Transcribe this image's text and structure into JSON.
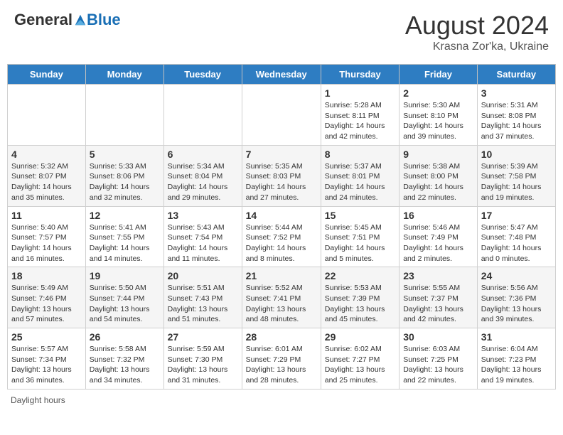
{
  "header": {
    "logo": {
      "general": "General",
      "blue": "Blue"
    },
    "title": "August 2024",
    "subtitle": "Krasna Zor'ka, Ukraine"
  },
  "calendar": {
    "days_of_week": [
      "Sunday",
      "Monday",
      "Tuesday",
      "Wednesday",
      "Thursday",
      "Friday",
      "Saturday"
    ],
    "weeks": [
      [
        {
          "day": "",
          "info": ""
        },
        {
          "day": "",
          "info": ""
        },
        {
          "day": "",
          "info": ""
        },
        {
          "day": "",
          "info": ""
        },
        {
          "day": "1",
          "info": "Sunrise: 5:28 AM\nSunset: 8:11 PM\nDaylight: 14 hours\nand 42 minutes."
        },
        {
          "day": "2",
          "info": "Sunrise: 5:30 AM\nSunset: 8:10 PM\nDaylight: 14 hours\nand 39 minutes."
        },
        {
          "day": "3",
          "info": "Sunrise: 5:31 AM\nSunset: 8:08 PM\nDaylight: 14 hours\nand 37 minutes."
        }
      ],
      [
        {
          "day": "4",
          "info": "Sunrise: 5:32 AM\nSunset: 8:07 PM\nDaylight: 14 hours\nand 35 minutes."
        },
        {
          "day": "5",
          "info": "Sunrise: 5:33 AM\nSunset: 8:06 PM\nDaylight: 14 hours\nand 32 minutes."
        },
        {
          "day": "6",
          "info": "Sunrise: 5:34 AM\nSunset: 8:04 PM\nDaylight: 14 hours\nand 29 minutes."
        },
        {
          "day": "7",
          "info": "Sunrise: 5:35 AM\nSunset: 8:03 PM\nDaylight: 14 hours\nand 27 minutes."
        },
        {
          "day": "8",
          "info": "Sunrise: 5:37 AM\nSunset: 8:01 PM\nDaylight: 14 hours\nand 24 minutes."
        },
        {
          "day": "9",
          "info": "Sunrise: 5:38 AM\nSunset: 8:00 PM\nDaylight: 14 hours\nand 22 minutes."
        },
        {
          "day": "10",
          "info": "Sunrise: 5:39 AM\nSunset: 7:58 PM\nDaylight: 14 hours\nand 19 minutes."
        }
      ],
      [
        {
          "day": "11",
          "info": "Sunrise: 5:40 AM\nSunset: 7:57 PM\nDaylight: 14 hours\nand 16 minutes."
        },
        {
          "day": "12",
          "info": "Sunrise: 5:41 AM\nSunset: 7:55 PM\nDaylight: 14 hours\nand 14 minutes."
        },
        {
          "day": "13",
          "info": "Sunrise: 5:43 AM\nSunset: 7:54 PM\nDaylight: 14 hours\nand 11 minutes."
        },
        {
          "day": "14",
          "info": "Sunrise: 5:44 AM\nSunset: 7:52 PM\nDaylight: 14 hours\nand 8 minutes."
        },
        {
          "day": "15",
          "info": "Sunrise: 5:45 AM\nSunset: 7:51 PM\nDaylight: 14 hours\nand 5 minutes."
        },
        {
          "day": "16",
          "info": "Sunrise: 5:46 AM\nSunset: 7:49 PM\nDaylight: 14 hours\nand 2 minutes."
        },
        {
          "day": "17",
          "info": "Sunrise: 5:47 AM\nSunset: 7:48 PM\nDaylight: 14 hours\nand 0 minutes."
        }
      ],
      [
        {
          "day": "18",
          "info": "Sunrise: 5:49 AM\nSunset: 7:46 PM\nDaylight: 13 hours\nand 57 minutes."
        },
        {
          "day": "19",
          "info": "Sunrise: 5:50 AM\nSunset: 7:44 PM\nDaylight: 13 hours\nand 54 minutes."
        },
        {
          "day": "20",
          "info": "Sunrise: 5:51 AM\nSunset: 7:43 PM\nDaylight: 13 hours\nand 51 minutes."
        },
        {
          "day": "21",
          "info": "Sunrise: 5:52 AM\nSunset: 7:41 PM\nDaylight: 13 hours\nand 48 minutes."
        },
        {
          "day": "22",
          "info": "Sunrise: 5:53 AM\nSunset: 7:39 PM\nDaylight: 13 hours\nand 45 minutes."
        },
        {
          "day": "23",
          "info": "Sunrise: 5:55 AM\nSunset: 7:37 PM\nDaylight: 13 hours\nand 42 minutes."
        },
        {
          "day": "24",
          "info": "Sunrise: 5:56 AM\nSunset: 7:36 PM\nDaylight: 13 hours\nand 39 minutes."
        }
      ],
      [
        {
          "day": "25",
          "info": "Sunrise: 5:57 AM\nSunset: 7:34 PM\nDaylight: 13 hours\nand 36 minutes."
        },
        {
          "day": "26",
          "info": "Sunrise: 5:58 AM\nSunset: 7:32 PM\nDaylight: 13 hours\nand 34 minutes."
        },
        {
          "day": "27",
          "info": "Sunrise: 5:59 AM\nSunset: 7:30 PM\nDaylight: 13 hours\nand 31 minutes."
        },
        {
          "day": "28",
          "info": "Sunrise: 6:01 AM\nSunset: 7:29 PM\nDaylight: 13 hours\nand 28 minutes."
        },
        {
          "day": "29",
          "info": "Sunrise: 6:02 AM\nSunset: 7:27 PM\nDaylight: 13 hours\nand 25 minutes."
        },
        {
          "day": "30",
          "info": "Sunrise: 6:03 AM\nSunset: 7:25 PM\nDaylight: 13 hours\nand 22 minutes."
        },
        {
          "day": "31",
          "info": "Sunrise: 6:04 AM\nSunset: 7:23 PM\nDaylight: 13 hours\nand 19 minutes."
        }
      ]
    ]
  },
  "footer": {
    "note": "Daylight hours"
  }
}
